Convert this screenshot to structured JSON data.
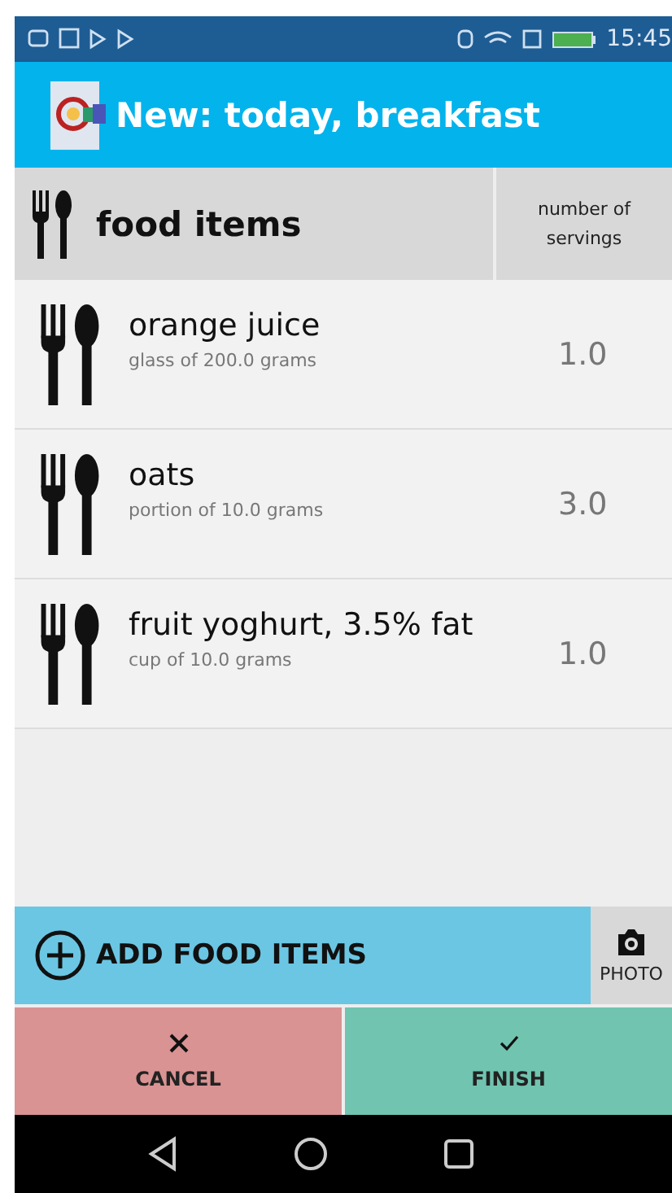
{
  "status_bar": {
    "time": "15:45"
  },
  "app_bar": {
    "title": "New: today, breakfast"
  },
  "table": {
    "columns": [
      "food items",
      "number of servings"
    ],
    "rows": [
      {
        "name": "orange juice",
        "portion": "glass of 200.0 grams",
        "servings": "1.0"
      },
      {
        "name": "oats",
        "portion": "portion of 10.0 grams",
        "servings": "3.0"
      },
      {
        "name": "fruit yoghurt, 3.5% fat",
        "portion": "cup of 10.0 grams",
        "servings": "1.0"
      }
    ]
  },
  "add_button": {
    "label": "ADD FOOD ITEMS"
  },
  "photo_button": {
    "label": "PHOTO"
  },
  "buttons": [
    {
      "kind": "cancel",
      "label": "CANCEL"
    },
    {
      "kind": "finish",
      "label": "FINISH"
    }
  ]
}
